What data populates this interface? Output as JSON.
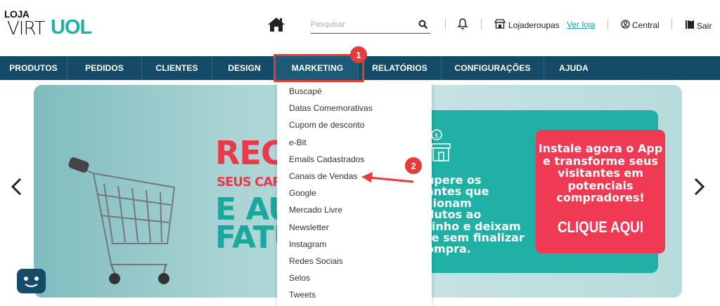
{
  "header": {
    "logo": {
      "line1": "LOJA",
      "line2": "VIRT",
      "line3": "UOL"
    },
    "search_placeholder": "Pesquisar",
    "store_label": "Lojaderoupas",
    "ver_loja": "Ver loja",
    "central": "Central",
    "sair": "Sair"
  },
  "nav": {
    "items": [
      {
        "label": "PRODUTOS"
      },
      {
        "label": "PEDIDOS"
      },
      {
        "label": "CLIENTES"
      },
      {
        "label": "DESIGN"
      },
      {
        "label": "MARKETING"
      },
      {
        "label": "RELATÓRIOS"
      },
      {
        "label": "CONFIGURAÇÕES"
      },
      {
        "label": "AJUDA"
      }
    ]
  },
  "annotations": {
    "badge1": "1",
    "badge2": "2"
  },
  "dropdown": {
    "items": [
      "Buscapé",
      "Datas Comemorativas",
      "Cupom de desconto",
      "e-Bit",
      "Emails Cadastrados",
      "Canais de Vendas",
      "Google",
      "Mercado Livre",
      "Newsletter",
      "Instagram",
      "Redes Sociais",
      "Selos",
      "Tweets"
    ]
  },
  "banner": {
    "red_big": "RECU",
    "red_sub": "SEUS CARRIN",
    "teal_big1": "E AUM",
    "teal_big2": "FATUR",
    "teal_text_lines": [
      "upere os",
      "antes que",
      "cionam",
      "dutos ao",
      "rinho e deixam",
      "te sem finalizar",
      "ompra."
    ],
    "card_lines": [
      "Instale agora o App",
      "e transforme seus",
      "visitantes em",
      "potenciais",
      "compradores!"
    ],
    "card_cta": "CLIQUE AQUI"
  },
  "colors": {
    "nav_bg": "#154b66",
    "accent_red": "#e53b3b",
    "teal": "#21b0a6",
    "card_red": "#f03a54",
    "link": "#1aa1b8"
  }
}
